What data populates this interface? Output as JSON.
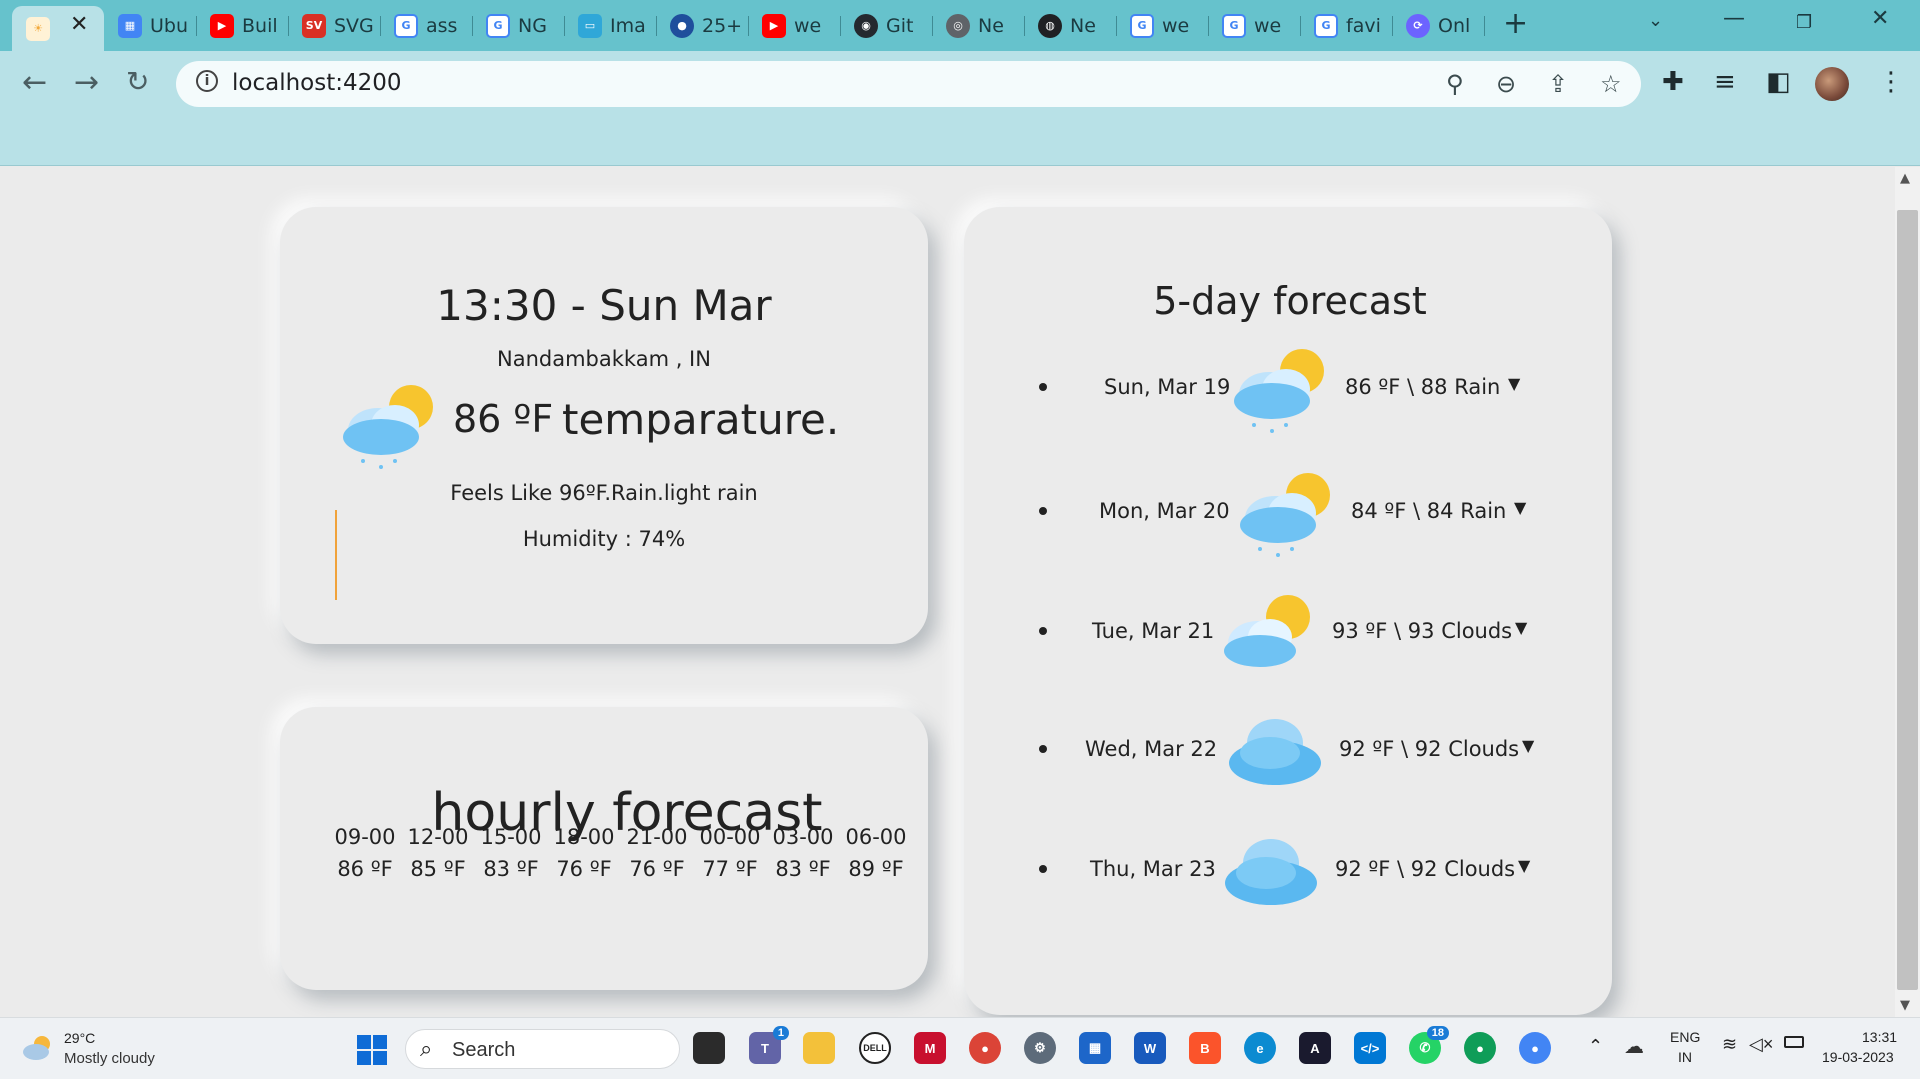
{
  "browser": {
    "tabs": [
      {
        "label": "",
        "icon": "weather-app-icon",
        "color": "#f2a93b"
      },
      {
        "label": "Ubu",
        "icon": "google-apps-icon",
        "color": "#4285f4"
      },
      {
        "label": "Buil",
        "icon": "youtube-icon",
        "color": "#ff0000"
      },
      {
        "label": "SVG",
        "icon": "svgpng-icon",
        "color": "#d93025"
      },
      {
        "label": "ass",
        "icon": "google-icon",
        "color": "#4285f4"
      },
      {
        "label": "NG",
        "icon": "google-icon",
        "color": "#4285f4"
      },
      {
        "label": "Ima",
        "icon": "image-icon",
        "color": "#2fa7d8"
      },
      {
        "label": "25+",
        "icon": "profile-icon",
        "color": "#1f4e9c"
      },
      {
        "label": "we",
        "icon": "youtube-icon",
        "color": "#ff0000"
      },
      {
        "label": "Git",
        "icon": "github-icon",
        "color": "#24292f"
      },
      {
        "label": "Ne",
        "icon": "chrome-icon",
        "color": "#5f6368"
      },
      {
        "label": "Ne",
        "icon": "globe-icon",
        "color": "#202124"
      },
      {
        "label": "we",
        "icon": "google-icon",
        "color": "#4285f4"
      },
      {
        "label": "we",
        "icon": "google-icon",
        "color": "#4285f4"
      },
      {
        "label": "favi",
        "icon": "google-icon",
        "color": "#4285f4"
      },
      {
        "label": "Onl",
        "icon": "convert-icon",
        "color": "#6c63ff"
      }
    ],
    "url": "localhost:4200"
  },
  "current": {
    "datetime": "13:30 - Sun Mar",
    "location": "Nandambakkam , IN",
    "temp": "86 ºF",
    "temp_word": "temparature.",
    "feels": "Feels Like 96ºF.Rain.light rain",
    "humidity": "Humidity : 74%"
  },
  "hourly": {
    "title": "hourly forecast",
    "items": [
      {
        "time": "09-00",
        "temp": "86 ºF"
      },
      {
        "time": "12-00",
        "temp": "85 ºF"
      },
      {
        "time": "15-00",
        "temp": "83 ºF"
      },
      {
        "time": "18-00",
        "temp": "76 ºF"
      },
      {
        "time": "21-00",
        "temp": "76 ºF"
      },
      {
        "time": "00-00",
        "temp": "77 ºF"
      },
      {
        "time": "03-00",
        "temp": "83 ºF"
      },
      {
        "time": "06-00",
        "temp": "89 ºF"
      }
    ]
  },
  "forecast": {
    "title": "5-day forecast",
    "days": [
      {
        "date": "Sun, Mar 19",
        "summary": "86 ºF \\ 88 Rain",
        "icon": "sun-cloud-rain-icon"
      },
      {
        "date": "Mon, Mar 20",
        "summary": "84 ºF \\ 84 Rain",
        "icon": "sun-cloud-rain-icon"
      },
      {
        "date": "Tue, Mar 21",
        "summary": "93 ºF \\ 93 Clouds",
        "icon": "sun-cloud-icon"
      },
      {
        "date": "Wed, Mar 22",
        "summary": "92 ºF \\ 92 Clouds",
        "icon": "cloud-icon"
      },
      {
        "date": "Thu, Mar 23",
        "summary": "92 ºF \\ 92 Clouds",
        "icon": "cloud-icon"
      }
    ]
  },
  "taskbar": {
    "weather_temp": "29°C",
    "weather_desc": "Mostly cloudy",
    "search": "Search",
    "lang1": "ENG",
    "lang2": "IN",
    "time": "13:31",
    "date": "19-03-2023",
    "teams_badge": "1",
    "whatsapp_badge": "18"
  },
  "colors": {
    "tabstrip": "#66c2cc",
    "toolbar": "#b8e1e7",
    "card_bg": "#ebebeb",
    "cloud_blue": "#5ab8f0",
    "sun_yellow": "#f7c52e"
  }
}
